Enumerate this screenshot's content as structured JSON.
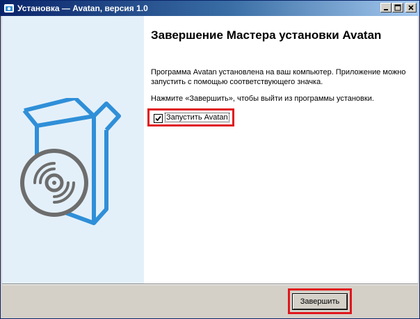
{
  "window": {
    "title": "Установка — Avatan, версия 1.0",
    "controls": {
      "minimize_icon": "minimize-icon",
      "maximize_icon": "maximize-icon",
      "close_icon": "close-icon"
    }
  },
  "main": {
    "heading": "Завершение Мастера установки Avatan",
    "paragraph1": "Программа Avatan установлена на ваш компьютер. Приложение можно запустить с помощью соответствующего значка.",
    "paragraph2": "Нажмите «Завершить», чтобы выйти из программы установки.",
    "run_checkbox": {
      "label": "Запустить Avatan",
      "checked": true
    }
  },
  "footer": {
    "finish_label": "Завершить"
  },
  "colors": {
    "highlight": "#e0161c",
    "side_panel": "#e4f0f9",
    "box_blue": "#2f8fd8",
    "disc_gray": "#6d6d6d"
  },
  "icons": {
    "side_panel_art": "box-with-disc-icon",
    "app_icon": "installer-icon"
  }
}
